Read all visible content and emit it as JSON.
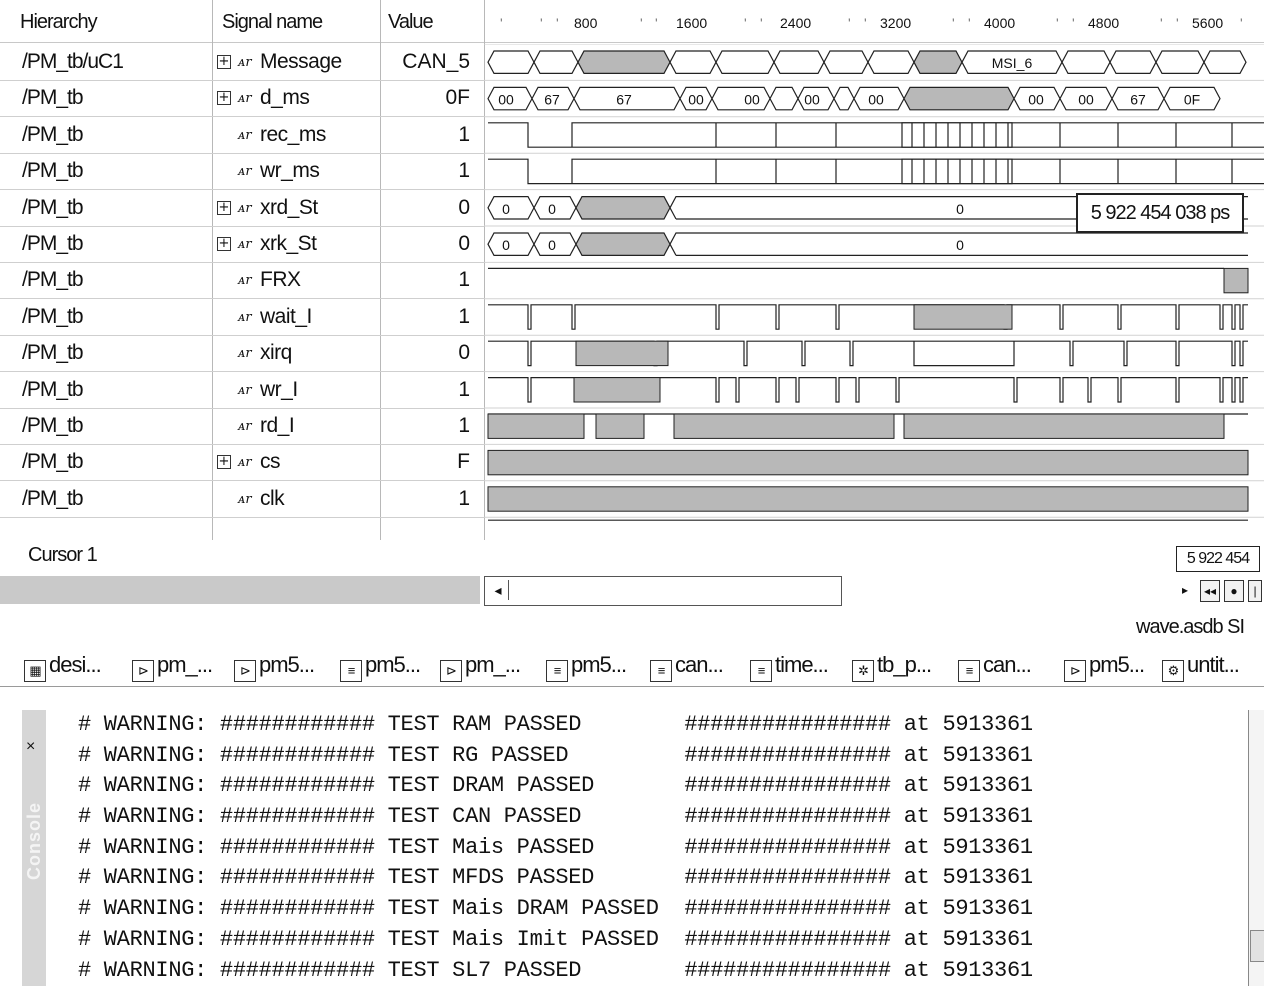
{
  "wave": {
    "headers": {
      "hierarchy": "Hierarchy",
      "signal_name": "Signal name",
      "value": "Value"
    },
    "time_ticks": [
      "800",
      "1600",
      "2400",
      "3200",
      "4000",
      "4800",
      "5600"
    ],
    "signals": [
      {
        "hier": "/PM_tb/uC1",
        "expand": true,
        "icon": "ᴀr",
        "name": "Message",
        "value": "CAN_5"
      },
      {
        "hier": "/PM_tb",
        "expand": true,
        "icon": "ᴀr",
        "name": "d_ms",
        "value": "0F"
      },
      {
        "hier": "/PM_tb",
        "expand": false,
        "icon": "ᴀr",
        "name": "rec_ms",
        "value": "1"
      },
      {
        "hier": "/PM_tb",
        "expand": false,
        "icon": "ᴀr",
        "name": "wr_ms",
        "value": "1"
      },
      {
        "hier": "/PM_tb",
        "expand": true,
        "icon": "ᴀr",
        "name": "xrd_St",
        "value": "0"
      },
      {
        "hier": "/PM_tb",
        "expand": true,
        "icon": "ᴀr",
        "name": "xrk_St",
        "value": "0"
      },
      {
        "hier": "/PM_tb",
        "expand": false,
        "icon": "ᴀr",
        "name": "FRX",
        "value": "1"
      },
      {
        "hier": "/PM_tb",
        "expand": false,
        "icon": "ᴀr",
        "name": "wait_I",
        "value": "1"
      },
      {
        "hier": "/PM_tb",
        "expand": false,
        "icon": "ᴀr",
        "name": "xirq",
        "value": "0"
      },
      {
        "hier": "/PM_tb",
        "expand": false,
        "icon": "ᴀr",
        "name": "wr_I",
        "value": "1"
      },
      {
        "hier": "/PM_tb",
        "expand": false,
        "icon": "ᴀr",
        "name": "rd_I",
        "value": "1"
      },
      {
        "hier": "/PM_tb",
        "expand": true,
        "icon": "ᴀr",
        "name": "cs",
        "value": "F"
      },
      {
        "hier": "/PM_tb",
        "expand": false,
        "icon": "ᴀr",
        "name": "clk",
        "value": "1"
      }
    ],
    "bus_labels": {
      "message": [
        "MSI_6"
      ],
      "d_ms": [
        "00",
        "67",
        "67",
        "00",
        "00",
        "00",
        "00",
        "00",
        "00",
        "67",
        "0F"
      ],
      "xrd_st": [
        "0",
        "0",
        "0"
      ],
      "xrk_st": [
        "0",
        "0",
        "0"
      ]
    },
    "timestamp_popup": "5 922 454 038 ps"
  },
  "cursor": {
    "label": "Cursor 1",
    "readout": "5 922 454"
  },
  "file_label": "wave.asdb  SI",
  "tabs": [
    {
      "icon": "design-icon",
      "glyph": "▦",
      "label": "desi..."
    },
    {
      "icon": "plug-icon",
      "glyph": "⊳",
      "label": "pm_..."
    },
    {
      "icon": "plug-icon",
      "glyph": "⊳",
      "label": "pm5..."
    },
    {
      "icon": "document-icon",
      "glyph": "≡",
      "label": "pm5..."
    },
    {
      "icon": "plug-icon",
      "glyph": "⊳",
      "label": "pm_..."
    },
    {
      "icon": "document-icon",
      "glyph": "≡",
      "label": "pm5..."
    },
    {
      "icon": "document-icon",
      "glyph": "≡",
      "label": "can..."
    },
    {
      "icon": "document-icon",
      "glyph": "≡",
      "label": "time..."
    },
    {
      "icon": "testbench-icon",
      "glyph": "✲",
      "label": "tb_p..."
    },
    {
      "icon": "document-icon",
      "glyph": "≡",
      "label": "can..."
    },
    {
      "icon": "plug-icon",
      "glyph": "⊳",
      "label": "pm5..."
    },
    {
      "icon": "unit-icon",
      "glyph": "⚙",
      "label": "untit..."
    }
  ],
  "console": {
    "side_label": "Console",
    "lines": [
      "# WARNING: ############ TEST RAM PASSED        ################ at 5913361",
      "# WARNING: ############ TEST RG PASSED         ################ at 5913361",
      "# WARNING: ############ TEST DRAM PASSED       ################ at 5913361",
      "# WARNING: ############ TEST CAN PASSED        ################ at 5913361",
      "# WARNING: ############ TEST Mais PASSED       ################ at 5913361",
      "# WARNING: ############ TEST MFDS PASSED       ################ at 5913361",
      "# WARNING: ############ TEST Mais DRAM PASSED  ################ at 5913361",
      "# WARNING: ############ TEST Mais Imit PASSED  ################ at 5913361",
      "# WARNING: ############ TEST SL7 PASSED        ################ at 5913361"
    ]
  }
}
